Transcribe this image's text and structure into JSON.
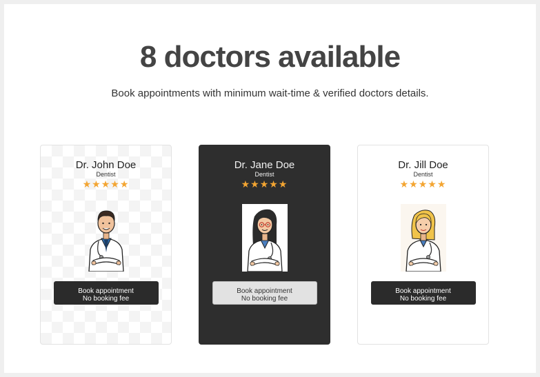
{
  "headline": "8 doctors available",
  "subheadline": "Book appointments with minimum wait-time & verified doctors details.",
  "doctors": [
    {
      "name": "Dr. John Doe",
      "specialty": "Dentist",
      "stars": "★★★★★",
      "rating": 5,
      "button_line1": "Book appointment",
      "button_line2": "No booking fee",
      "icon": "doctor-male-portrait"
    },
    {
      "name": "Dr. Jane Doe",
      "specialty": "Dentist",
      "stars": "★★★★★",
      "rating": 5,
      "button_line1": "Book appointment",
      "button_line2": "No booking fee",
      "icon": "doctor-female-glasses-portrait"
    },
    {
      "name": "Dr. Jill Doe",
      "specialty": "Dentist",
      "stars": "★★★★★",
      "rating": 5,
      "button_line1": "Book appointment",
      "button_line2": "No booking fee",
      "icon": "doctor-female-blonde-portrait"
    }
  ],
  "colors": {
    "star": "#f3a532",
    "dark_card": "#2e2e2e",
    "button_dark": "#2b2b2b",
    "button_light": "#e2e2e2"
  }
}
